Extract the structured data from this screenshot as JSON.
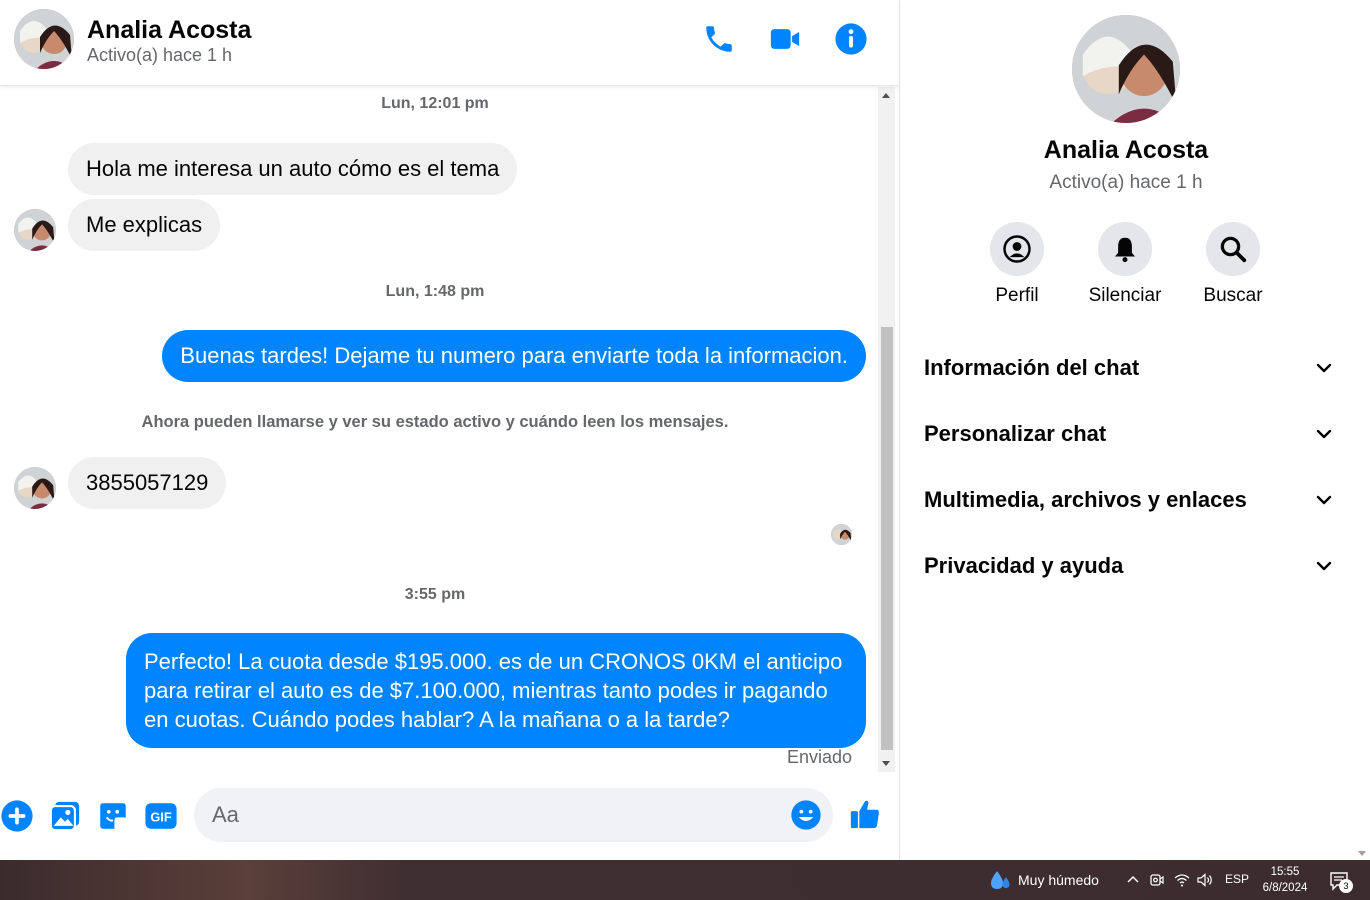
{
  "contact": {
    "name": "Analia Acosta",
    "status": "Activo(a) hace 1 h"
  },
  "header": {
    "icons": [
      "phone-icon",
      "video-camera-icon",
      "info-icon"
    ],
    "accent_color": "#0084ff"
  },
  "messages": {
    "ts1": "Lun, 12:01 pm",
    "in1": "Hola me interesa un auto cómo es el tema",
    "in2": "Me explicas",
    "ts2": "Lun, 1:48 pm",
    "out1": "Buenas tardes! Dejame tu numero para enviarte toda la informacion.",
    "notice": "Ahora pueden llamarse y ver su estado activo y cuándo leen los mensajes.",
    "in3": "3855057129",
    "ts3": "3:55 pm",
    "out2": "Perfecto! La cuota desde $195.000. es de un CRONOS 0KM el anticipo para retirar el auto es de $7.100.000, mientras tanto podes ir pagando en cuotas. Cuándo podes hablar? A la mañana o a la tarde?",
    "sent_status": "Enviado"
  },
  "composer": {
    "placeholder": "Aa",
    "icons": [
      "plus-icon",
      "image-icon",
      "sticker-icon",
      "gif-icon",
      "emoji-icon",
      "thumbs-up-icon"
    ],
    "gif_text": "GIF"
  },
  "panel": {
    "actions": [
      {
        "label": "Perfil",
        "icon": "profile-icon"
      },
      {
        "label": "Silenciar",
        "icon": "bell-icon"
      },
      {
        "label": "Buscar",
        "icon": "search-icon"
      }
    ],
    "sections": [
      {
        "label": "Información del chat"
      },
      {
        "label": "Personalizar chat"
      },
      {
        "label": "Multimedia, archivos y enlaces"
      },
      {
        "label": "Privacidad y ayuda"
      }
    ]
  },
  "taskbar": {
    "weather": "Muy húmedo",
    "language": "ESP",
    "time": "15:55",
    "date": "6/8/2024",
    "notification_count": "3"
  }
}
